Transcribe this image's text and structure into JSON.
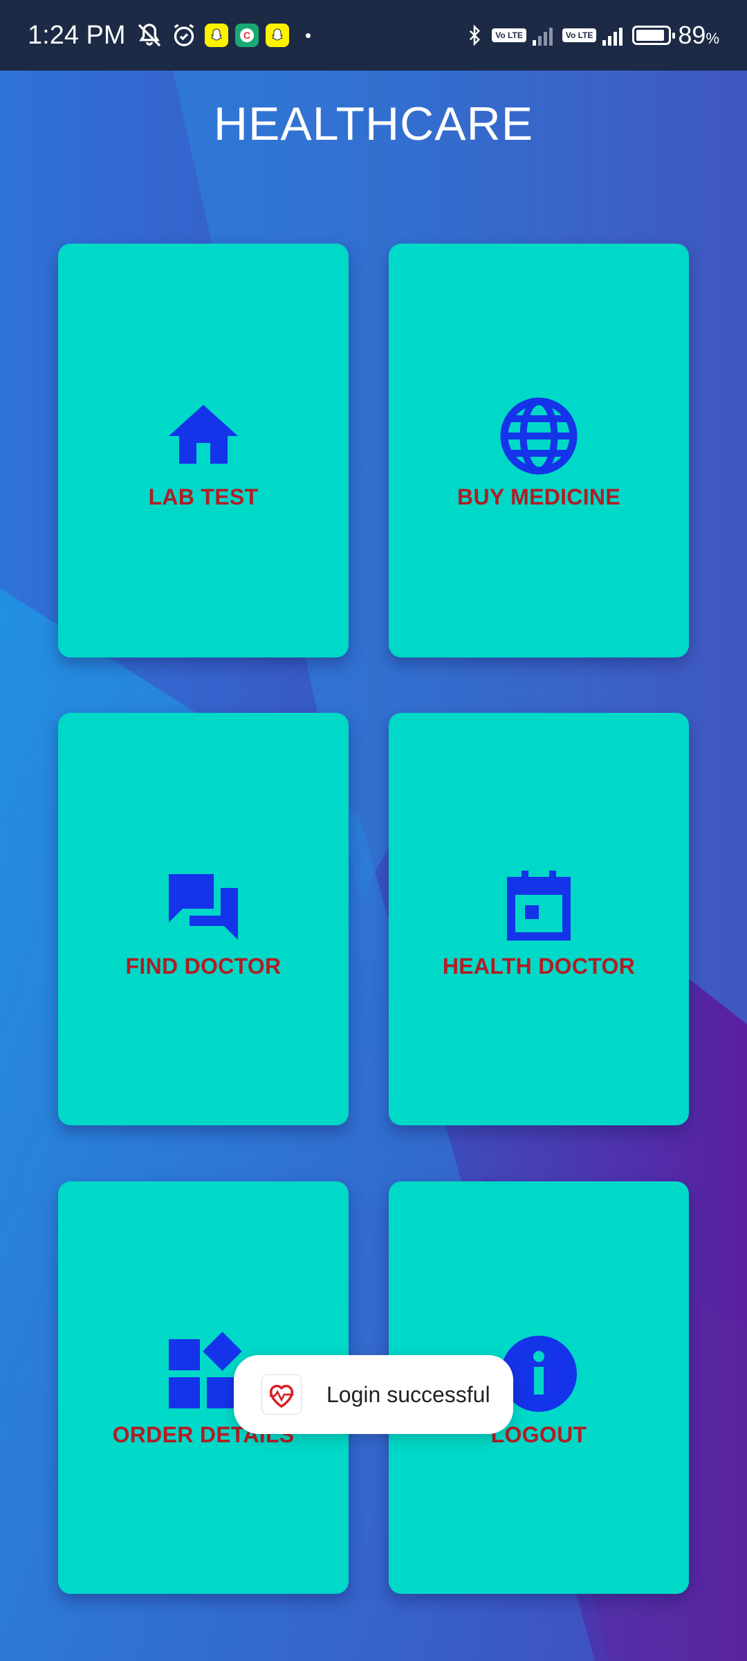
{
  "status_bar": {
    "time": "1:24 PM",
    "battery_percent": "89",
    "battery_unit": "%",
    "battery_level": 0.89,
    "icons": [
      "mute-icon",
      "alarm-icon",
      "snapchat-icon",
      "app-c-icon",
      "snapchat-icon",
      "notification-dot",
      "bluetooth-icon",
      "volte-icon",
      "signal-icon",
      "volte-icon",
      "signal-icon",
      "battery-icon"
    ],
    "volte_label": "Vo LTE"
  },
  "header": {
    "title": "HEALTHCARE"
  },
  "cards": [
    {
      "label": "LAB TEST",
      "icon": "home-icon"
    },
    {
      "label": "BUY MEDICINE",
      "icon": "globe-icon"
    },
    {
      "label": "FIND DOCTOR",
      "icon": "chat-icon"
    },
    {
      "label": "HEALTH DOCTOR",
      "icon": "calendar-icon"
    },
    {
      "label": "ORDER DETAILS",
      "icon": "widgets-icon"
    },
    {
      "label": "LOGOUT",
      "icon": "info-icon"
    }
  ],
  "toast": {
    "message": "Login successful",
    "icon": "app-heart-icon"
  },
  "colors": {
    "card": "#00d8c8",
    "icon": "#1533e8",
    "label": "#b01e24",
    "status_bar": "#1c2a45"
  }
}
